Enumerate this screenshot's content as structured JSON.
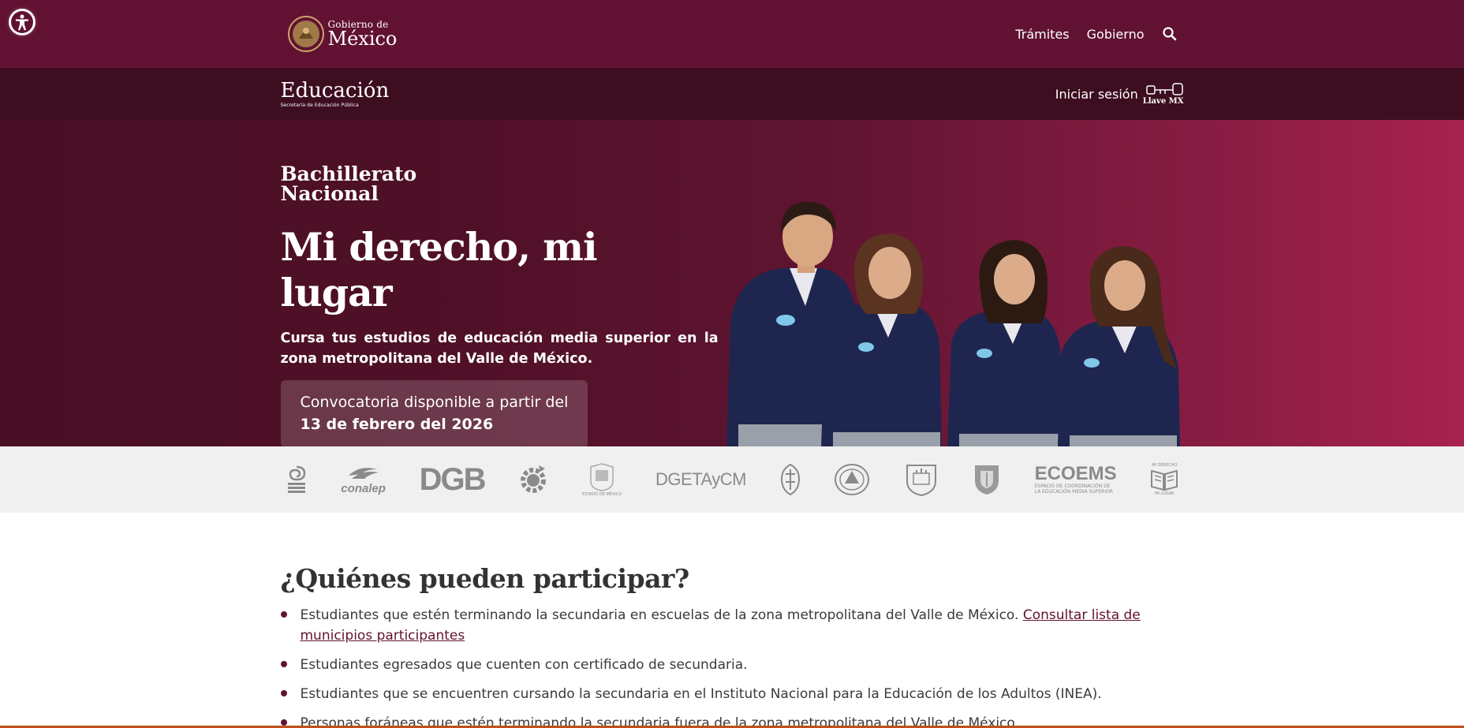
{
  "gov_header": {
    "logo_small": "Gobierno de",
    "logo_big": "México",
    "nav": [
      {
        "label": "Trámites"
      },
      {
        "label": "Gobierno"
      }
    ]
  },
  "sub_header": {
    "logo_big": "Educación",
    "logo_small": "Secretaría de Educación Pública",
    "login_label": "Iniciar sesión",
    "llave_label": "Llave MX"
  },
  "hero": {
    "program_line1": "Bachillerato",
    "program_line2": "Nacional",
    "title": "Mi derecho, mi lugar",
    "description": "Cursa tus estudios de educación media superior en la zona metropolitana del Valle de México.",
    "convocatoria_text": "Convocatoria disponible a partir del",
    "convocatoria_date": "13 de febrero del 2026"
  },
  "partners": {
    "conalep": "conalep",
    "dgb": "DGB",
    "dgeta": "DGETAyCM",
    "ecoems": "ECOEMS",
    "ecoems_sub1": "ESPACIO DE COORDINACIÓN DE",
    "ecoems_sub2": "LA EDUCACIÓN MEDIA SUPERIOR",
    "milugar_top": "MI DERECHO",
    "milugar_bottom": "MI LUGAR",
    "edomex_sub": "ESTADO DE MÉXICO"
  },
  "content": {
    "title": "¿Quiénes pueden participar?",
    "items": [
      {
        "text": "Estudiantes que estén terminando la secundaria en escuelas de la zona metropolitana del Valle de México. ",
        "link": "Consultar lista de municipios participantes"
      },
      {
        "text": "Estudiantes egresados que cuenten con certificado de secundaria."
      },
      {
        "text": "Estudiantes que se encuentren cursando la secundaria en el Instituto Nacional para la Educación de los Adultos (INEA)."
      },
      {
        "text": "Personas foráneas que estén terminando la secundaria fuera de la zona metropolitana del Valle de México."
      }
    ]
  },
  "colors": {
    "gov_bar": "#611232",
    "sub_bar": "#3d0d20",
    "hero_start": "#4a0f25",
    "hero_end": "#a8224e",
    "logos_bar": "#f0f0f0"
  }
}
